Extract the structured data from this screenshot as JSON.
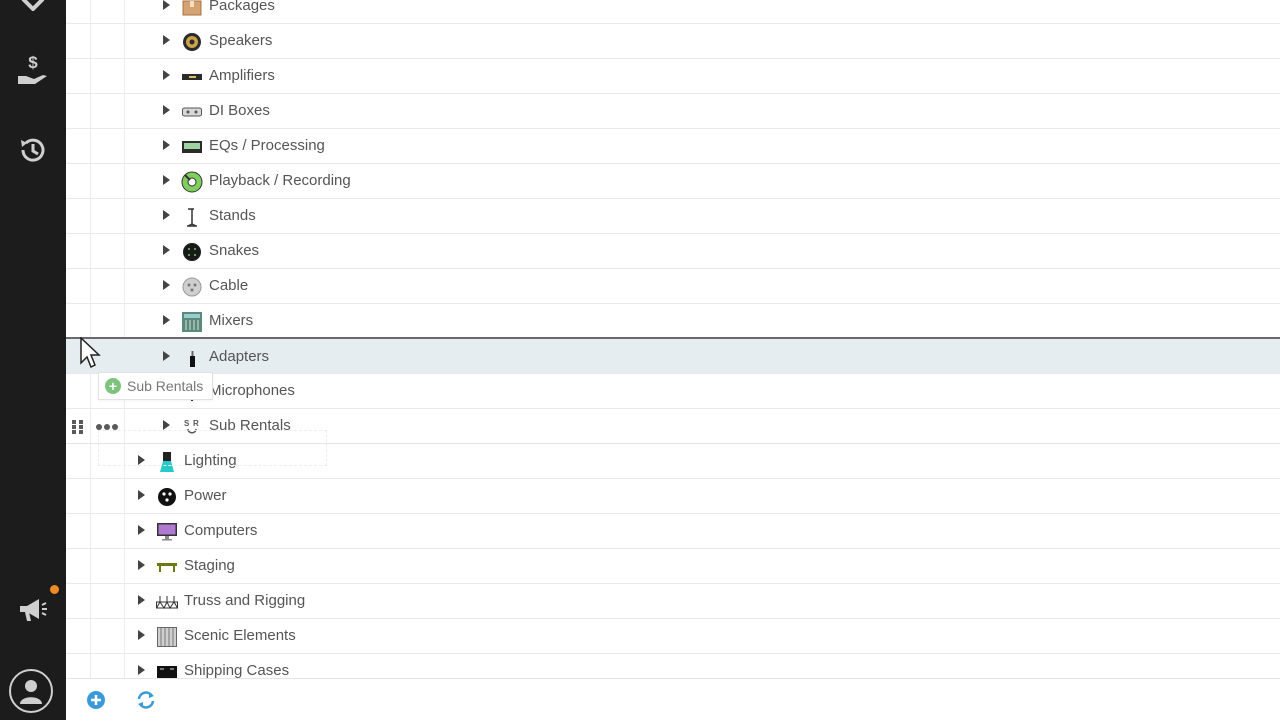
{
  "sidebar": {
    "icons": [
      "dollar-hand-icon",
      "history-icon",
      "megaphone-icon",
      "user-avatar-icon"
    ],
    "notification_color": "#f08a24"
  },
  "tree": {
    "sub_items": [
      {
        "label": "Packages",
        "icon": "package-icon"
      },
      {
        "label": "Speakers",
        "icon": "speaker-icon"
      },
      {
        "label": "Amplifiers",
        "icon": "amplifier-icon"
      },
      {
        "label": "DI Boxes",
        "icon": "di-box-icon"
      },
      {
        "label": "EQs / Processing",
        "icon": "eq-icon"
      },
      {
        "label": "Playback / Recording",
        "icon": "playback-icon"
      },
      {
        "label": "Stands",
        "icon": "stand-icon"
      },
      {
        "label": "Snakes",
        "icon": "snake-icon"
      },
      {
        "label": "Cable",
        "icon": "cable-icon"
      },
      {
        "label": "Mixers",
        "icon": "mixer-icon"
      },
      {
        "label": "Adapters",
        "icon": "adapter-icon"
      },
      {
        "label": "Microphones",
        "icon": "microphone-icon"
      },
      {
        "label": "Sub Rentals",
        "icon": "sub-rentals-icon"
      }
    ],
    "top_items": [
      {
        "label": "Lighting",
        "icon": "lighting-icon"
      },
      {
        "label": "Power",
        "icon": "power-icon"
      },
      {
        "label": "Computers",
        "icon": "computer-icon"
      },
      {
        "label": "Staging",
        "icon": "staging-icon"
      },
      {
        "label": "Truss and Rigging",
        "icon": "truss-icon"
      },
      {
        "label": "Scenic Elements",
        "icon": "scenic-icon"
      },
      {
        "label": "Shipping Cases",
        "icon": "shipping-case-icon"
      }
    ]
  },
  "drag_ghost": {
    "label": "Sub Rentals"
  },
  "footer": {
    "icons": [
      "add-icon",
      "refresh-icon"
    ],
    "accent": "#3a9ad9"
  }
}
